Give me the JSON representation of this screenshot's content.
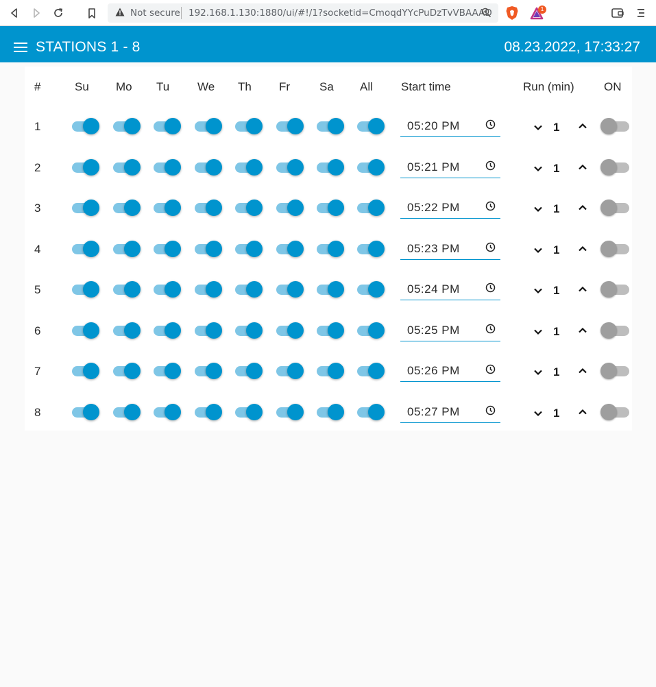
{
  "browser": {
    "security_label": "Not secure",
    "url": "192.168.1.130:1880/ui/#!/1?socketid=CmoqdYYcPuDzTvVBAAAD",
    "badge_count": "1"
  },
  "header": {
    "title": "STATIONS 1 - 8",
    "datetime": "08.23.2022, 17:33:27"
  },
  "columns": [
    "#",
    "Su",
    "Mo",
    "Tu",
    "We",
    "Th",
    "Fr",
    "Sa",
    "All",
    "Start time",
    "Run (min)",
    "ON"
  ],
  "rows": [
    {
      "num": "1",
      "days": [
        true,
        true,
        true,
        true,
        true,
        true,
        true
      ],
      "all": true,
      "start_time": "05:20 PM",
      "run": "1",
      "on": false
    },
    {
      "num": "2",
      "days": [
        true,
        true,
        true,
        true,
        true,
        true,
        true
      ],
      "all": true,
      "start_time": "05:21 PM",
      "run": "1",
      "on": false
    },
    {
      "num": "3",
      "days": [
        true,
        true,
        true,
        true,
        true,
        true,
        true
      ],
      "all": true,
      "start_time": "05:22 PM",
      "run": "1",
      "on": false
    },
    {
      "num": "4",
      "days": [
        true,
        true,
        true,
        true,
        true,
        true,
        true
      ],
      "all": true,
      "start_time": "05:23 PM",
      "run": "1",
      "on": false
    },
    {
      "num": "5",
      "days": [
        true,
        true,
        true,
        true,
        true,
        true,
        true
      ],
      "all": true,
      "start_time": "05:24 PM",
      "run": "1",
      "on": false
    },
    {
      "num": "6",
      "days": [
        true,
        true,
        true,
        true,
        true,
        true,
        true
      ],
      "all": true,
      "start_time": "05:25 PM",
      "run": "1",
      "on": false
    },
    {
      "num": "7",
      "days": [
        true,
        true,
        true,
        true,
        true,
        true,
        true
      ],
      "all": true,
      "start_time": "05:26 PM",
      "run": "1",
      "on": false
    },
    {
      "num": "8",
      "days": [
        true,
        true,
        true,
        true,
        true,
        true,
        true
      ],
      "all": true,
      "start_time": "05:27 PM",
      "run": "1",
      "on": false
    }
  ],
  "colors": {
    "accent": "#0094ce",
    "accent_light": "#7fc6e6",
    "off_knob": "#9e9e9e",
    "off_track": "#bdbdbd"
  },
  "icons": {
    "menu": "hamburger-icon",
    "clock": "clock-icon",
    "decrement": "chevron-down-icon",
    "increment": "chevron-up-icon"
  }
}
